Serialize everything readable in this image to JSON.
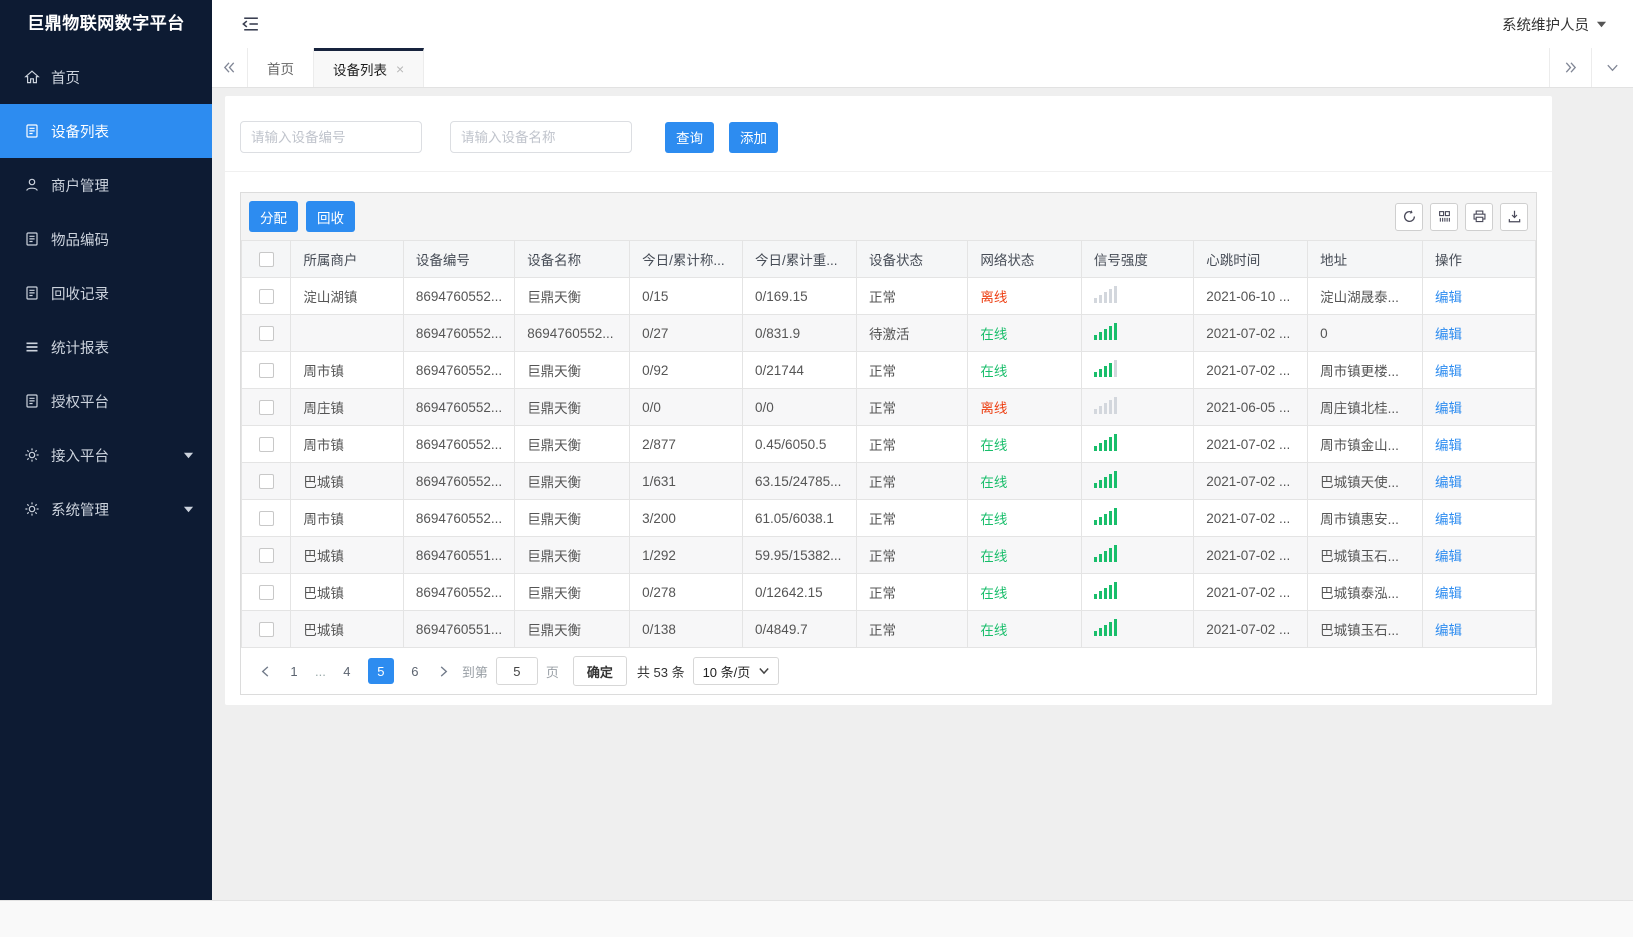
{
  "colors": {
    "accent": "#2d8cf0",
    "online": "#19be6b",
    "offline": "#ed4014",
    "sidebar_bg": "#0d1b33"
  },
  "sidebar": {
    "title": "巨鼎物联网数字平台",
    "items": [
      {
        "slug": "home",
        "label": "首页",
        "icon": "home-icon",
        "active": false,
        "arrow": false
      },
      {
        "slug": "device-list",
        "label": "设备列表",
        "icon": "document-icon",
        "active": true,
        "arrow": false
      },
      {
        "slug": "merchant-manage",
        "label": "商户管理",
        "icon": "user-icon",
        "active": false,
        "arrow": false
      },
      {
        "slug": "item-code",
        "label": "物品编码",
        "icon": "document-icon",
        "active": false,
        "arrow": false
      },
      {
        "slug": "recycle-records",
        "label": "回收记录",
        "icon": "document-icon",
        "active": false,
        "arrow": false
      },
      {
        "slug": "statistics-report",
        "label": "统计报表",
        "icon": "list-icon",
        "active": false,
        "arrow": false
      },
      {
        "slug": "authorize-platform",
        "label": "授权平台",
        "icon": "document-icon",
        "active": false,
        "arrow": false
      },
      {
        "slug": "access-platform",
        "label": "接入平台",
        "icon": "gear-icon",
        "active": false,
        "arrow": true
      },
      {
        "slug": "system-manage",
        "label": "系统管理",
        "icon": "gear-icon",
        "active": false,
        "arrow": true
      }
    ]
  },
  "header": {
    "user": "系统维护人员"
  },
  "tabs": [
    {
      "slug": "home",
      "label": "首页",
      "active": false,
      "closable": false
    },
    {
      "slug": "device-list",
      "label": "设备列表",
      "active": true,
      "closable": true
    }
  ],
  "search": {
    "device_no_placeholder": "请输入设备编号",
    "device_name_placeholder": "请输入设备名称",
    "query_label": "查询",
    "add_label": "添加"
  },
  "toolbar": {
    "assign_label": "分配",
    "recycle_label": "回收",
    "icons": [
      "refresh-icon",
      "columns-icon",
      "print-icon",
      "export-icon"
    ]
  },
  "table": {
    "headers": [
      "所属商户",
      "设备编号",
      "设备名称",
      "今日/累计称...",
      "今日/累计重...",
      "设备状态",
      "网络状态",
      "信号强度",
      "心跳时间",
      "地址",
      "操作"
    ],
    "edit_label": "编辑",
    "rows": [
      {
        "merchant": "淀山湖镇",
        "device_no": "8694760552...",
        "device_name": "巨鼎天衡",
        "today_count": "0/15",
        "today_weight": "0/169.15",
        "device_status": "正常",
        "network_status": "离线",
        "online": false,
        "signal": 0,
        "heartbeat": "2021-06-10 ...",
        "address": "淀山湖晟泰..."
      },
      {
        "merchant": "",
        "device_no": "8694760552...",
        "device_name": "8694760552...",
        "today_count": "0/27",
        "today_weight": "0/831.9",
        "device_status": "待激活",
        "network_status": "在线",
        "online": true,
        "signal": 5,
        "heartbeat": "2021-07-02 ...",
        "address": "0"
      },
      {
        "merchant": "周市镇",
        "device_no": "8694760552...",
        "device_name": "巨鼎天衡",
        "today_count": "0/92",
        "today_weight": "0/21744",
        "device_status": "正常",
        "network_status": "在线",
        "online": true,
        "signal": 4,
        "heartbeat": "2021-07-02 ...",
        "address": "周市镇更楼..."
      },
      {
        "merchant": "周庄镇",
        "device_no": "8694760552...",
        "device_name": "巨鼎天衡",
        "today_count": "0/0",
        "today_weight": "0/0",
        "device_status": "正常",
        "network_status": "离线",
        "online": false,
        "signal": 0,
        "heartbeat": "2021-06-05 ...",
        "address": "周庄镇北桂..."
      },
      {
        "merchant": "周市镇",
        "device_no": "8694760552...",
        "device_name": "巨鼎天衡",
        "today_count": "2/877",
        "today_weight": "0.45/6050.5",
        "device_status": "正常",
        "network_status": "在线",
        "online": true,
        "signal": 5,
        "heartbeat": "2021-07-02 ...",
        "address": "周市镇金山..."
      },
      {
        "merchant": "巴城镇",
        "device_no": "8694760552...",
        "device_name": "巨鼎天衡",
        "today_count": "1/631",
        "today_weight": "63.15/24785...",
        "device_status": "正常",
        "network_status": "在线",
        "online": true,
        "signal": 5,
        "heartbeat": "2021-07-02 ...",
        "address": "巴城镇天使..."
      },
      {
        "merchant": "周市镇",
        "device_no": "8694760552...",
        "device_name": "巨鼎天衡",
        "today_count": "3/200",
        "today_weight": "61.05/6038.1",
        "device_status": "正常",
        "network_status": "在线",
        "online": true,
        "signal": 5,
        "heartbeat": "2021-07-02 ...",
        "address": "周市镇惠安..."
      },
      {
        "merchant": "巴城镇",
        "device_no": "8694760551...",
        "device_name": "巨鼎天衡",
        "today_count": "1/292",
        "today_weight": "59.95/15382...",
        "device_status": "正常",
        "network_status": "在线",
        "online": true,
        "signal": 5,
        "heartbeat": "2021-07-02 ...",
        "address": "巴城镇玉石..."
      },
      {
        "merchant": "巴城镇",
        "device_no": "8694760552...",
        "device_name": "巨鼎天衡",
        "today_count": "0/278",
        "today_weight": "0/12642.15",
        "device_status": "正常",
        "network_status": "在线",
        "online": true,
        "signal": 5,
        "heartbeat": "2021-07-02 ...",
        "address": "巴城镇泰泓..."
      },
      {
        "merchant": "巴城镇",
        "device_no": "8694760551...",
        "device_name": "巨鼎天衡",
        "today_count": "0/138",
        "today_weight": "0/4849.7",
        "device_status": "正常",
        "network_status": "在线",
        "online": true,
        "signal": 5,
        "heartbeat": "2021-07-02 ...",
        "address": "巴城镇玉石..."
      }
    ]
  },
  "pagination": {
    "pages": [
      "1",
      "...",
      "4",
      "5",
      "6"
    ],
    "active_page": "5",
    "goto_label": "到第",
    "goto_value": "5",
    "page_unit": "页",
    "confirm_label": "确定",
    "total_label": "共 53 条",
    "page_size": "10 条/页"
  }
}
